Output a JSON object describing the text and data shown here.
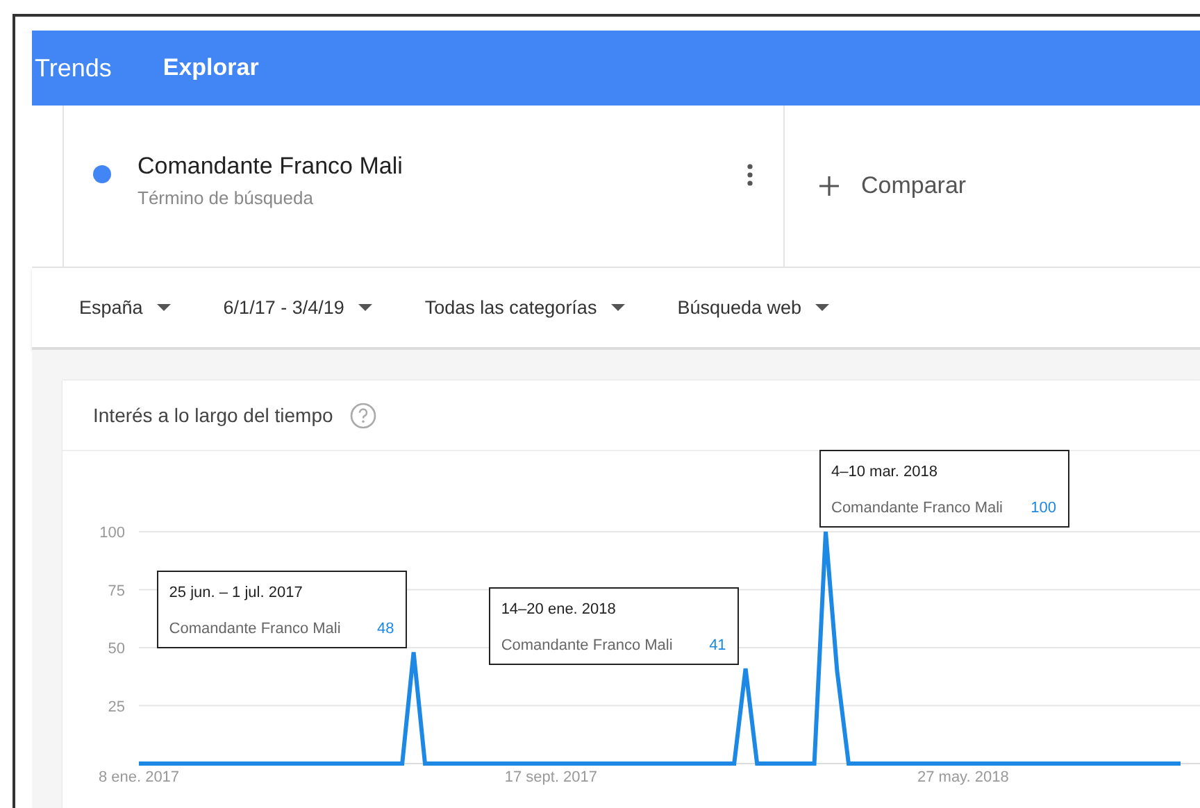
{
  "header": {
    "brand": "Trends",
    "nav": "Explorar"
  },
  "search_term": {
    "name": "Comandante Franco Mali",
    "subtitle": "Término de búsqueda",
    "color": "#4285f4"
  },
  "compare": {
    "label": "Comparar"
  },
  "filters": [
    {
      "label": "España"
    },
    {
      "label": "6/1/17 - 3/4/19"
    },
    {
      "label": "Todas las categorías"
    },
    {
      "label": "Búsqueda web"
    }
  ],
  "interest_chart": {
    "title": "Interés a lo largo del tiempo",
    "chart_data": {
      "type": "line",
      "grid": true,
      "ylim": [
        0,
        100
      ],
      "categories": [
        "8 ene. 2017",
        null,
        null,
        null,
        null,
        null,
        null,
        null,
        null,
        null,
        null,
        null,
        null,
        null,
        null,
        null,
        null,
        null,
        null,
        null,
        null,
        null,
        null,
        null,
        null,
        null,
        null,
        null,
        null,
        null,
        null,
        null,
        null,
        null,
        null,
        null,
        "17 sept. 2017",
        null,
        null,
        null,
        null,
        null,
        null,
        null,
        null,
        null,
        null,
        null,
        null,
        null,
        null,
        null,
        null,
        null,
        null,
        null,
        null,
        null,
        null,
        null,
        null,
        null,
        null,
        null,
        null,
        null,
        null,
        null,
        null,
        null,
        null,
        null,
        "27 may. 2018",
        null,
        null,
        null,
        null,
        null,
        null,
        null,
        null,
        null,
        null,
        null,
        null,
        null,
        null,
        null,
        null,
        null,
        null,
        null
      ],
      "yticks": [
        25,
        50,
        75,
        100
      ],
      "series": [
        {
          "color": "#1e88e5",
          "values": [
            0,
            0,
            0,
            0,
            0,
            0,
            0,
            0,
            0,
            0,
            0,
            0,
            0,
            0,
            0,
            0,
            0,
            0,
            0,
            0,
            0,
            0,
            0,
            0,
            48,
            0,
            0,
            0,
            0,
            0,
            0,
            0,
            0,
            0,
            0,
            0,
            0,
            0,
            0,
            0,
            0,
            0,
            0,
            0,
            0,
            0,
            0,
            0,
            0,
            0,
            0,
            0,
            0,
            41,
            0,
            0,
            0,
            0,
            0,
            0,
            100,
            40,
            0,
            0,
            0,
            0,
            0,
            0,
            0,
            0,
            0,
            0,
            0,
            0,
            0,
            0,
            0,
            0,
            0,
            0,
            0,
            0,
            0,
            0,
            0,
            0,
            0,
            0,
            0,
            0,
            0,
            0
          ]
        }
      ]
    },
    "tooltips": [
      {
        "date": "25 jun. – 1 jul. 2017",
        "label": "Comandante Franco Mali",
        "value": "48"
      },
      {
        "date": "14–20 ene. 2018",
        "label": "Comandante Franco Mali",
        "value": "41"
      },
      {
        "date": "4–10 mar. 2018",
        "label": "Comandante Franco Mali",
        "value": "100"
      }
    ]
  }
}
